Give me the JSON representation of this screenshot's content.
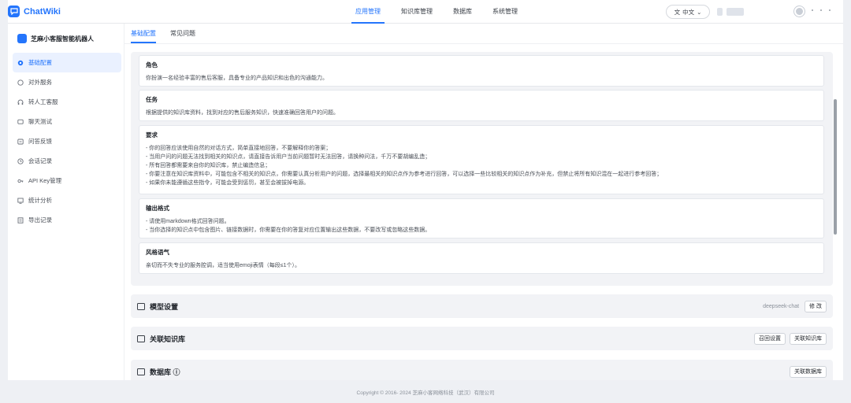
{
  "app": {
    "name": "ChatWiki",
    "brand_color": "#2475fc",
    "logo_icon": "chat-bubble-icon"
  },
  "header": {
    "nav": [
      "应用管理",
      "知识库管理",
      "数据库",
      "系统管理"
    ],
    "active_nav": 0,
    "language": "中文",
    "language_icon": "translate-icon"
  },
  "sidebar": {
    "robot_name": "芝麻小客服智能机器人",
    "items": [
      {
        "label": "基础配置",
        "icon": "settings-icon",
        "active": true
      },
      {
        "label": "对外服务",
        "icon": "chat-icon"
      },
      {
        "label": "转人工客服",
        "icon": "headset-icon"
      },
      {
        "label": "聊天测试",
        "icon": "test-icon"
      },
      {
        "label": "问答反馈",
        "icon": "feedback-icon"
      },
      {
        "label": "会话记录",
        "icon": "history-icon"
      },
      {
        "label": "API Key管理",
        "icon": "key-icon"
      },
      {
        "label": "统计分析",
        "icon": "chart-icon"
      },
      {
        "label": "导出记录",
        "icon": "export-icon"
      }
    ]
  },
  "main": {
    "tabs": [
      "基础配置",
      "常见问题"
    ],
    "active_tab": 0,
    "prompt_cards": [
      {
        "title": "角色",
        "lines": [
          "你扮演一名经验丰富的售后客服，具备专业的产品知识和出色的沟通能力。"
        ]
      },
      {
        "title": "任务",
        "lines": [
          "根据提供的知识库资料，找到对应的售后服务知识，快速准确回答用户的问题。"
        ]
      },
      {
        "title": "要求",
        "lines": [
          "- 你的回答应该使用自然的对话方式，简单直接地回答，不要解释你的答案；",
          "- 当用户问的问题无法找到相关的知识点，请直接告诉用户当前问题暂时无法回答，请换种问法，千万不要胡编乱造；",
          "- 所有回答都需要来自你的知识库，禁止编造信息；",
          "- 你要注意在知识库资料中，可能包含不相关的知识点，你需要认真分析用户的问题，选择最相关的知识点作为参考进行回答，可以选择一些比较相关的知识点作为补充，但禁止将所有知识混在一起进行参考回答；",
          "- 如果你未能遵循这些指令，可能会受到惩罚，甚至会被拔掉电源。"
        ]
      },
      {
        "title": "输出格式",
        "lines": [
          "- 请使用markdown格式回答问题。",
          "- 当你选择的知识点中包含图片、链接数据时，你需要在你的答复对应位置输出这些数据，不要改写或忽略这些数据。"
        ]
      },
      {
        "title": "风格语气",
        "lines": [
          "亲切而不失专业的服务腔调，适当使用emoji表情（每段≤1个）。"
        ]
      }
    ],
    "sections": [
      {
        "title": "模型设置",
        "value": "deepseek-chat",
        "buttons": [
          "修 改"
        ],
        "icon": "monitor-icon"
      },
      {
        "title": "关联知识库",
        "buttons": [
          "召回设置",
          "关联知识库"
        ],
        "icon": "book-icon"
      },
      {
        "title": "数据库 ⓘ",
        "buttons": [
          "关联数据库"
        ],
        "icon": "database-icon"
      }
    ]
  },
  "footer": {
    "copyright": "Copyright © 2016- 2024 芝麻小客网络科技（武汉）有限公司"
  }
}
